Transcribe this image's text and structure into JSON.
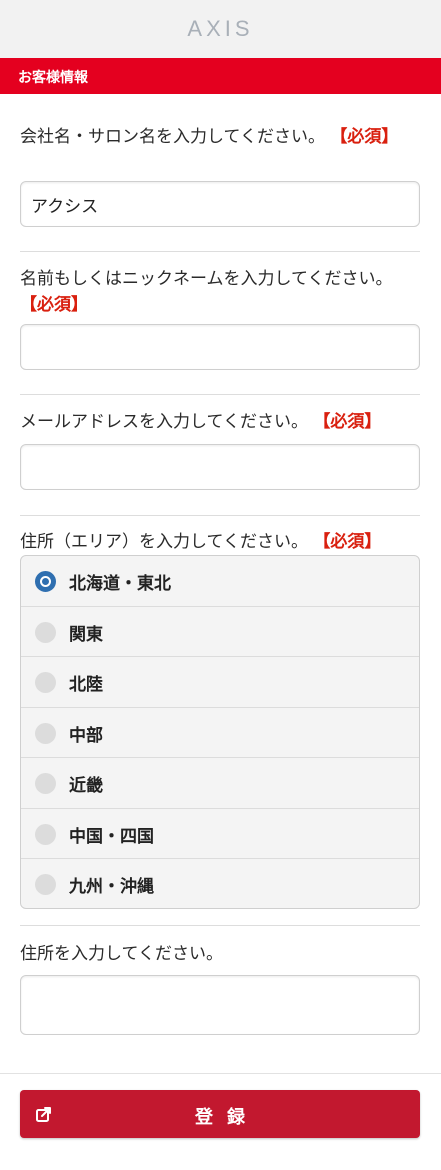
{
  "header": {
    "logo_text": "AXIS"
  },
  "section": {
    "title": "お客様情報"
  },
  "form": {
    "salon_name": {
      "label": "会社名・サロン名を入力してください。",
      "required": "【必須】",
      "value": "アクシス"
    },
    "nickname": {
      "label": "名前もしくはニックネームを入力してください。",
      "required": "【必須】",
      "value": ""
    },
    "email": {
      "label": "メールアドレスを入力してください。",
      "required": "【必須】",
      "value": ""
    },
    "area": {
      "label": "住所（エリア）を入力してください。",
      "required": "【必須】",
      "selected": "北海道・東北",
      "options": [
        "北海道・東北",
        "関東",
        "北陸",
        "中部",
        "近畿",
        "中国・四国",
        "九州・沖縄"
      ]
    },
    "address": {
      "label": "住所を入力してください。",
      "value": ""
    }
  },
  "submit": {
    "label": "登録",
    "icon": "share-icon"
  },
  "colors": {
    "brand_red": "#e4001f",
    "button_red": "#c2182f",
    "required_red": "#d9200f",
    "radio_blue": "#2f6fb0"
  }
}
